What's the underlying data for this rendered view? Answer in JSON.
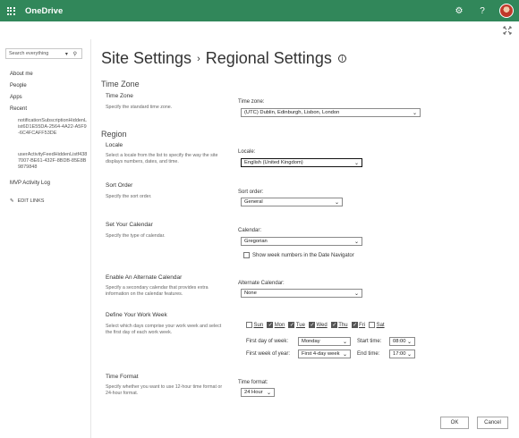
{
  "suite": {
    "brand": "OneDrive",
    "colors": {
      "suite_bar": "#31875a"
    }
  },
  "leftnav": {
    "search_placeholder": "Search everything",
    "items": [
      "About me",
      "People",
      "Apps",
      "Recent"
    ],
    "recent": [
      "notificationSubscriptionHiddenList6D1E55DA-2564-4A22-A5F9-6C4FCAFF53DE",
      "userActivityFeedHiddenListf4387007-BE61-432F-8BDB-85E8B9879848"
    ],
    "mvp": "MVP Activity Log",
    "edit_links": "EDIT LINKS"
  },
  "title": {
    "part1": "Site Settings",
    "sep": "›",
    "part2": "Regional Settings"
  },
  "time_zone": {
    "group": "Time Zone",
    "title": "Time Zone",
    "desc": "Specify the standard time zone.",
    "label": "Time zone:",
    "value": "(UTC) Dublin, Edinburgh, Lisbon, London"
  },
  "region": {
    "group": "Region",
    "locale": {
      "title": "Locale",
      "desc": "Select a locale from the list to specify the way the site displays numbers, dates, and time.",
      "label": "Locale:",
      "value": "English (United Kingdom)"
    },
    "sort": {
      "title": "Sort Order",
      "desc": "Specify the sort order.",
      "label": "Sort order:",
      "value": "General"
    },
    "calendar": {
      "title": "Set Your Calendar",
      "desc": "Specify the type of calendar.",
      "label": "Calendar:",
      "value": "Gregorian",
      "week_numbers": "Show week numbers in the Date Navigator"
    },
    "alt_calendar": {
      "title": "Enable An Alternate Calendar",
      "desc": "Specify a secondary calendar that provides extra information on the calendar features.",
      "label": "Alternate Calendar:",
      "value": "None"
    },
    "work_week": {
      "title": "Define Your Work Week",
      "desc": "Select which days comprise your work week and select the first day of each work week.",
      "days": [
        "Sun",
        "Mon",
        "Tue",
        "Wed",
        "Thu",
        "Fri",
        "Sat"
      ],
      "first_day_label": "First day of week:",
      "first_day": "Monday",
      "first_week_label": "First week of year:",
      "first_week": "First 4-day week",
      "start_label": "Start time:",
      "start": "08:00",
      "end_label": "End time:",
      "end": "17:00"
    },
    "time_format": {
      "title": "Time Format",
      "desc": "Specify whether you want to use 12-hour time format or 24-hour format.",
      "label": "Time format:",
      "value": "24 Hour"
    }
  },
  "buttons": {
    "ok": "OK",
    "cancel": "Cancel"
  }
}
